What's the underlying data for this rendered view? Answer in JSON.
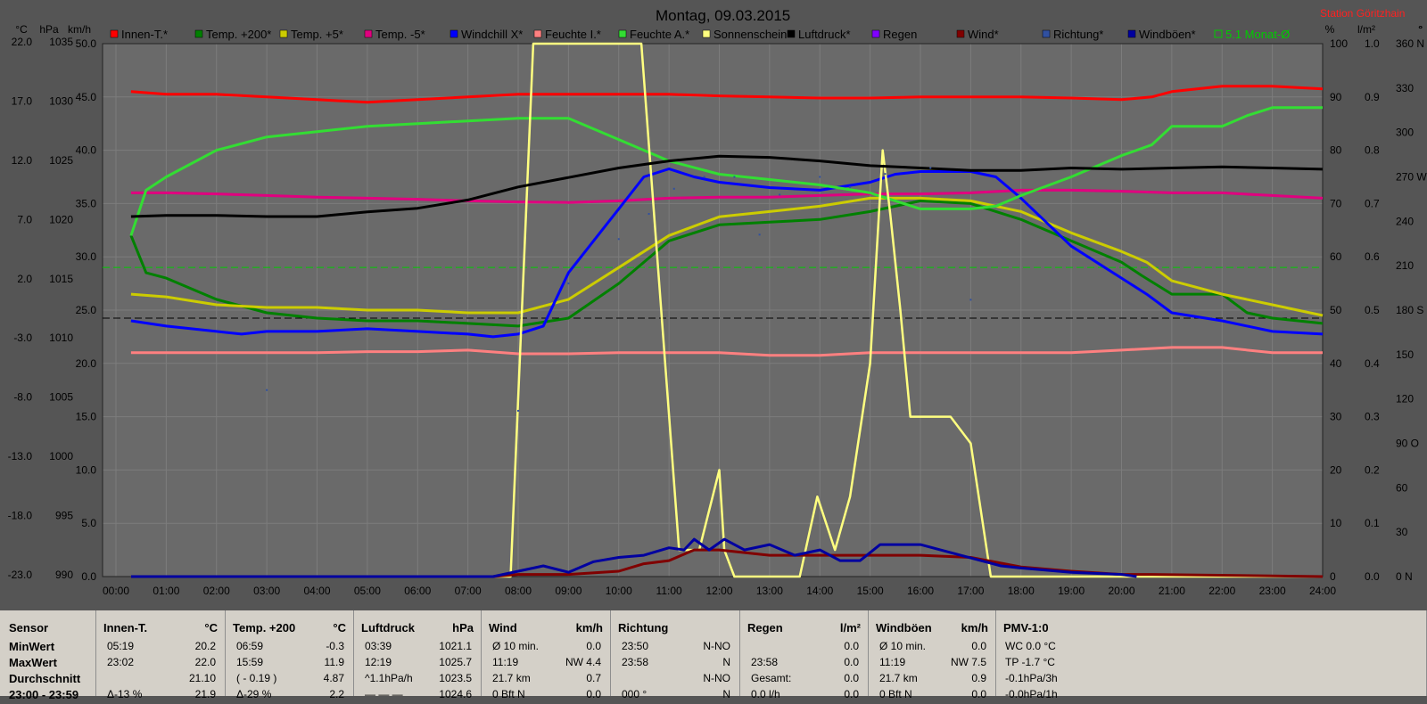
{
  "chart_data": {
    "type": "line",
    "title": "Montag, 09.03.2015",
    "station": "Station Göritzhain",
    "x_ticks": [
      "00:00",
      "01:00",
      "02:00",
      "03:00",
      "04:00",
      "05:00",
      "06:00",
      "07:00",
      "08:00",
      "09:00",
      "10:00",
      "11:00",
      "12:00",
      "13:00",
      "14:00",
      "15:00",
      "16:00",
      "17:00",
      "18:00",
      "19:00",
      "20:00",
      "21:00",
      "22:00",
      "23:00",
      "24:00"
    ],
    "xlim": [
      0,
      24
    ],
    "grid": true,
    "legend_position": "top",
    "left_axes": [
      {
        "unit": "°C",
        "ticks": [
          "22.0",
          "17.0",
          "12.0",
          "7.0",
          "2.0",
          "-3.0",
          "-8.0",
          "-13.0",
          "-18.0",
          "-23.0"
        ],
        "range": [
          -23,
          22
        ]
      },
      {
        "unit": "hPa",
        "ticks": [
          "1035",
          "1030",
          "1025",
          "1020",
          "1015",
          "1010",
          "1005",
          "1000",
          "995",
          "990"
        ],
        "range": [
          990,
          1035
        ]
      },
      {
        "unit": "km/h",
        "ticks": [
          "50.0",
          "45.0",
          "40.0",
          "35.0",
          "30.0",
          "25.0",
          "20.0",
          "15.0",
          "10.0",
          "5.0",
          "0.0"
        ],
        "range": [
          0,
          50
        ]
      }
    ],
    "right_axes": [
      {
        "unit": "%",
        "ticks": [
          "100",
          "90",
          "80",
          "70",
          "60",
          "50",
          "40",
          "30",
          "20",
          "10",
          "0"
        ],
        "range": [
          0,
          100
        ]
      },
      {
        "unit": "l/m²",
        "ticks": [
          "1.0",
          "0.9",
          "0.8",
          "0.7",
          "0.6",
          "0.5",
          "0.4",
          "0.3",
          "0.2",
          "0.1",
          "0.0"
        ],
        "range": [
          0,
          1
        ]
      },
      {
        "unit": "°",
        "ticks": [
          "360 N",
          "330",
          "300",
          "270 W",
          "240",
          "210",
          "180 S",
          "150",
          "120",
          "90 O",
          "60",
          "30",
          "0 N"
        ],
        "range": [
          0,
          360
        ]
      }
    ],
    "series": [
      {
        "name": "Innen-T.*",
        "color": "#ff0000",
        "axis": "%",
        "x": [
          0.3,
          1,
          2,
          3,
          4,
          5,
          6,
          7,
          8,
          9,
          10,
          11,
          12,
          13,
          14,
          15,
          16,
          17,
          18,
          19,
          20,
          20.6,
          21,
          22,
          23,
          24
        ],
        "y": [
          91,
          90.5,
          90.5,
          90,
          89.5,
          89,
          89.5,
          90,
          90.5,
          90.5,
          90.5,
          90.5,
          90.2,
          90,
          89.8,
          89.8,
          90,
          90,
          90,
          89.8,
          89.5,
          90,
          91,
          92,
          92,
          91.5
        ]
      },
      {
        "name": "Temp. +200*",
        "color": "#008000",
        "axis": "%",
        "x": [
          0.3,
          0.6,
          1,
          2,
          3,
          4,
          5,
          6,
          7,
          8,
          9,
          10,
          11,
          12,
          13,
          14,
          15,
          16,
          17,
          18,
          19,
          20,
          20.4,
          21,
          22,
          22.5,
          23,
          24
        ],
        "y": [
          64,
          57,
          56,
          52,
          49.5,
          48.5,
          48,
          48,
          47.5,
          47,
          48.5,
          55,
          63,
          66,
          66.5,
          67,
          68.5,
          70.5,
          70,
          67,
          63,
          59,
          56.5,
          53,
          53,
          49.5,
          48.5,
          47.5
        ]
      },
      {
        "name": "Temp. +5*",
        "color": "#cccc00",
        "axis": "%",
        "x": [
          0.3,
          1,
          2,
          3,
          4,
          5,
          6,
          7,
          8,
          9,
          10,
          11,
          12,
          13,
          14,
          15,
          16,
          17,
          18,
          19,
          20,
          20.5,
          21,
          22,
          23,
          24
        ],
        "y": [
          53,
          52.5,
          51,
          50.5,
          50.5,
          50,
          50,
          49.5,
          49.5,
          52,
          58,
          64,
          67.5,
          68.5,
          69.5,
          71,
          71,
          70.5,
          68.5,
          64.5,
          61,
          59,
          55.5,
          53,
          51,
          49
        ]
      },
      {
        "name": "Temp. -5*",
        "color": "#e0007f",
        "axis": "%",
        "x": [
          0.3,
          1,
          2,
          3,
          4,
          5,
          6,
          7,
          8,
          9,
          10,
          11,
          12,
          13,
          14,
          15,
          16,
          17,
          18,
          19,
          20,
          21,
          22,
          23,
          24
        ],
        "y": [
          72,
          72,
          71.8,
          71.5,
          71.2,
          71,
          70.8,
          70.5,
          70.3,
          70.2,
          70.5,
          71,
          71.2,
          71.2,
          71.5,
          71.8,
          71.8,
          72,
          72.5,
          72.5,
          72.3,
          72,
          72,
          71.5,
          71
        ]
      },
      {
        "name": "Windchill X*",
        "color": "#0000ff",
        "axis": "%",
        "x": [
          0.3,
          1,
          2,
          2.5,
          3,
          4,
          5,
          6,
          7,
          7.5,
          8,
          8.5,
          9,
          10,
          10.5,
          11,
          11.5,
          12,
          13,
          14,
          15,
          15.5,
          16,
          17,
          17.5,
          18,
          19,
          20,
          20.5,
          21,
          22,
          23,
          24
        ],
        "y": [
          48,
          47,
          46,
          45.5,
          46,
          46,
          46.5,
          46,
          45.5,
          45,
          45.5,
          47,
          57,
          69,
          75,
          76.5,
          75,
          74,
          73,
          72.5,
          74,
          75.5,
          76,
          76,
          75,
          71,
          62,
          56,
          53,
          49.5,
          48,
          46,
          45.5
        ]
      },
      {
        "name": "Feuchte I.*",
        "color": "#ff8080",
        "axis": "%",
        "x": [
          0.3,
          1,
          2,
          3,
          4,
          5,
          6,
          7,
          8,
          9,
          10,
          11,
          12,
          13,
          14,
          15,
          16,
          17,
          18,
          19,
          20,
          21,
          22,
          23,
          24
        ],
        "y": [
          42,
          42,
          42,
          42,
          42,
          42.2,
          42.2,
          42.5,
          41.8,
          41.8,
          42,
          42,
          42,
          41.5,
          41.5,
          42,
          42,
          42,
          42,
          42,
          42.5,
          43,
          43,
          42,
          42
        ]
      },
      {
        "name": "Feuchte A.*",
        "color": "#33dd33",
        "axis": "%",
        "x": [
          0.3,
          0.6,
          1,
          2,
          3,
          4,
          5,
          6,
          7,
          8,
          8.5,
          9,
          10,
          11,
          12,
          13,
          14,
          15,
          15.5,
          16,
          17,
          17.5,
          18,
          19,
          20,
          20.6,
          21,
          22,
          22.5,
          23,
          24
        ],
        "y": [
          64,
          72.5,
          75,
          80,
          82.5,
          83.5,
          84.5,
          85,
          85.5,
          86,
          86,
          86,
          82,
          78,
          75.5,
          74.5,
          73.5,
          72,
          70.5,
          69,
          69,
          69.5,
          71.5,
          75,
          79,
          81,
          84.5,
          84.5,
          86.5,
          88,
          88
        ]
      },
      {
        "name": "Sonnenschein",
        "color": "#ffff80",
        "axis": "%",
        "x": [
          0.3,
          7.5,
          7.85,
          8.3,
          9,
          10,
          10.45,
          11.2,
          11.3,
          11.6,
          12,
          12.1,
          12.3,
          13,
          13.6,
          13.95,
          14.3,
          14.6,
          15,
          15.25,
          15.4,
          15.6,
          15.8,
          16.2,
          16.6,
          17,
          17.4,
          18,
          24
        ],
        "y": [
          0,
          0,
          0,
          100,
          100,
          100,
          100,
          5,
          5,
          5,
          20,
          5,
          0,
          0,
          0,
          15,
          5,
          15,
          40,
          80,
          68,
          50,
          30,
          30,
          30,
          25,
          0,
          0,
          0
        ]
      },
      {
        "name": "Luftdruck*",
        "color": "#000000",
        "axis": "hPa",
        "x": [
          0.3,
          1,
          2,
          3,
          4,
          5,
          6,
          7,
          8,
          9,
          10,
          11,
          12,
          13,
          14,
          15,
          16,
          17,
          18,
          19,
          20,
          21,
          22,
          23,
          24
        ],
        "y": [
          1020.4,
          1020.5,
          1020.5,
          1020.4,
          1020.4,
          1020.8,
          1021.1,
          1021.8,
          1022.9,
          1023.7,
          1024.5,
          1025.1,
          1025.5,
          1025.4,
          1025.1,
          1024.7,
          1024.5,
          1024.3,
          1024.3,
          1024.5,
          1024.4,
          1024.5,
          1024.6,
          1024.5,
          1024.4
        ]
      },
      {
        "name": "Regen",
        "color": "#8000ff",
        "axis": "l/m²",
        "x": [],
        "y": []
      },
      {
        "name": "Wind*",
        "color": "#800000",
        "axis": "km/h",
        "x": [
          0.3,
          3,
          5,
          7.5,
          8,
          9,
          10,
          10.5,
          11,
          11.5,
          12,
          13,
          14,
          15,
          16,
          17,
          18,
          19,
          20,
          20.6,
          24
        ],
        "y": [
          0,
          0,
          0,
          0,
          0.2,
          0.2,
          0.5,
          1.2,
          1.5,
          2.5,
          2.5,
          2,
          2,
          2,
          2,
          1.8,
          0.9,
          0.5,
          0.2,
          0.2,
          0
        ]
      },
      {
        "name": "Richtung*",
        "color": "#3050a0",
        "axis": "°",
        "x": [
          3,
          8,
          9,
          10,
          10.6,
          11.1,
          11.7,
          12.3,
          12.8,
          13.2,
          14,
          14.6,
          15.3,
          16.2,
          17
        ],
        "y": [
          126,
          112,
          198,
          228,
          245,
          262,
          270,
          270,
          231,
          258,
          270,
          263,
          272,
          276,
          187
        ]
      },
      {
        "name": "Windböen*",
        "color": "#0000a0",
        "axis": "km/h",
        "x": [
          0.3,
          7.5,
          8,
          8.5,
          9,
          9.5,
          10,
          10.5,
          11,
          11.3,
          11.5,
          11.8,
          12.1,
          12.5,
          13,
          13.5,
          14,
          14.4,
          14.8,
          15.2,
          15.6,
          16,
          16.4,
          16.8,
          17.2,
          17.6,
          18,
          19,
          20,
          20.3
        ],
        "y": [
          0,
          0,
          0.5,
          1,
          0.4,
          1.4,
          1.8,
          2,
          2.7,
          2.5,
          3.5,
          2.5,
          3.5,
          2.5,
          3,
          2,
          2.5,
          1.5,
          1.5,
          3,
          3,
          3,
          2.5,
          2,
          1.5,
          1,
          0.8,
          0.4,
          0.2,
          0
        ]
      }
    ],
    "reference_lines": [
      {
        "name": "5.1 Monat-Ø",
        "color": "#00cc00",
        "style": "dashed",
        "axis": "%",
        "value": 58
      },
      {
        "name": "zero line",
        "color": "#000000",
        "style": "dashed",
        "axis": "%",
        "value": 48.5
      }
    ],
    "legend_extra": "5.1 Monat-Ø",
    "top_right_unit_extra": "°"
  },
  "stats": {
    "sensor": {
      "header": "Sensor",
      "rows": [
        "MinWert",
        "MaxWert",
        "Durchschnitt",
        "23:00 - 23:59"
      ]
    },
    "innen": {
      "header": "Innen-T.",
      "unit": "°C",
      "rows": [
        [
          "05:19",
          "20.2"
        ],
        [
          "23:02",
          "22.0"
        ],
        [
          "",
          "21.10"
        ],
        [
          "Δ-13 %",
          "21.9"
        ]
      ]
    },
    "temp200": {
      "header": "Temp. +200",
      "unit": "°C",
      "rows": [
        [
          "06:59",
          "-0.3"
        ],
        [
          "15:59",
          "11.9"
        ],
        [
          "( - 0.19 )",
          "4.87"
        ],
        [
          "Δ-29 %",
          "2.2"
        ]
      ]
    },
    "luftdruck": {
      "header": "Luftdruck",
      "unit": "hPa",
      "rows": [
        [
          "03:39",
          "1021.1"
        ],
        [
          "12:19",
          "1025.7"
        ],
        [
          "^1.1hPa/h",
          "1023.5"
        ],
        [
          "— — —",
          "1024.6"
        ]
      ]
    },
    "wind": {
      "header": "Wind",
      "unit": "km/h",
      "rows": [
        [
          "Ø 10 min.",
          "0.0"
        ],
        [
          "11:19",
          "NW 4.4"
        ],
        [
          "21.7 km",
          "0.7"
        ],
        [
          "0 Bft N",
          "0.0"
        ]
      ]
    },
    "richtung": {
      "header": "Richtung",
      "rows": [
        [
          "23:50",
          "N-NO"
        ],
        [
          "23:58",
          "N"
        ],
        [
          "",
          "N-NO"
        ],
        [
          "000 °",
          "N"
        ]
      ]
    },
    "regen": {
      "header": "Regen",
      "unit": "l/m²",
      "rows": [
        [
          "",
          "0.0"
        ],
        [
          "23:58",
          "0.0"
        ],
        [
          "Gesamt:",
          "0.0"
        ],
        [
          "0.0 l/h",
          "0.0"
        ]
      ]
    },
    "windboeen": {
      "header": "Windböen",
      "unit": "km/h",
      "rows": [
        [
          "Ø 10 min.",
          "0.0"
        ],
        [
          "11:19",
          "NW 7.5"
        ],
        [
          "21.7 km",
          "0.9"
        ],
        [
          "0 Bft N",
          "0.0"
        ]
      ]
    },
    "pmv": {
      "header": "PMV-1:0",
      "rows": [
        "WC 0.0 °C",
        "TP -1.7 °C",
        "-0.1hPa/3h",
        "-0.0hPa/1h"
      ]
    }
  }
}
